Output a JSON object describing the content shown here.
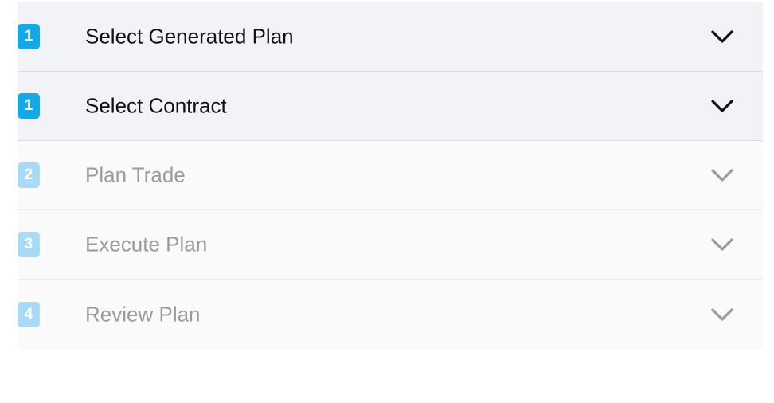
{
  "steps": [
    {
      "number": "1",
      "label": "Select Generated Plan",
      "state": "active",
      "icon": "chevron-down-icon"
    },
    {
      "number": "1",
      "label": "Select Contract",
      "state": "active",
      "icon": "chevron-down-icon"
    },
    {
      "number": "2",
      "label": "Plan Trade",
      "state": "inactive",
      "icon": "chevron-down-icon"
    },
    {
      "number": "3",
      "label": "Execute Plan",
      "state": "inactive",
      "icon": "chevron-down-icon"
    },
    {
      "number": "4",
      "label": "Review Plan",
      "state": "inactive",
      "icon": "chevron-down-icon"
    }
  ],
  "colors": {
    "active_badge": "#13a9e8",
    "inactive_badge": "#a9daf5",
    "active_text": "#111111",
    "inactive_text": "#9b9b9b",
    "active_bg": "#f2f3f7",
    "inactive_bg": "#fafafa"
  }
}
